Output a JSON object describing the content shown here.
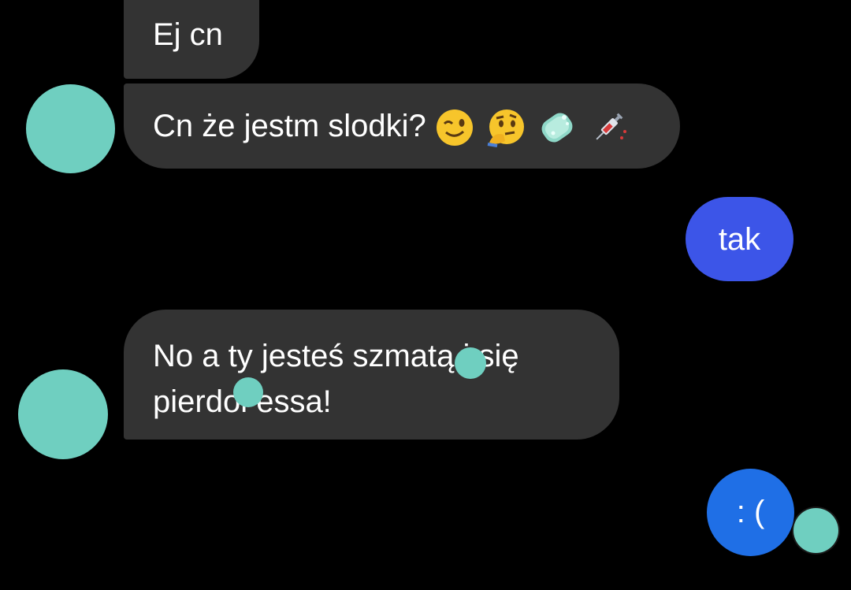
{
  "messages": {
    "m1": {
      "text": "Ej cn"
    },
    "m2": {
      "text": "Cn że jestm slodki?",
      "emojis": [
        "winking-face-icon",
        "thinking-face-icon",
        "soap-icon",
        "syringe-icon"
      ]
    },
    "m3": {
      "text": "tak"
    },
    "m4": {
      "line1": "No a ty jesteś szmatą i się",
      "line2": "pierdol essa!"
    },
    "m5": {
      "text": ": ("
    }
  },
  "colors": {
    "background": "#000000",
    "incoming_bubble": "#333333",
    "outgoing_tak": "#3c55e8",
    "outgoing_sad": "#1f6fe6",
    "redaction": "#6fcfc0"
  }
}
